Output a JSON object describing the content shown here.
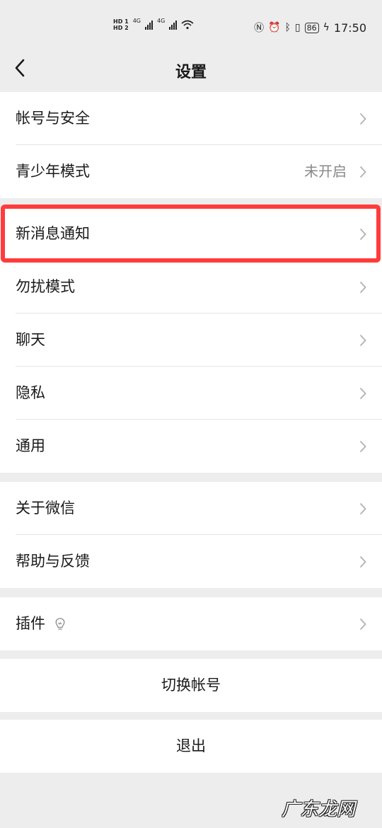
{
  "status_bar": {
    "hd1": "HD 1",
    "hd2": "HD 2",
    "network_1": "4G",
    "network_2": "4G",
    "battery": "86",
    "time": "17:50",
    "icons": [
      "wifi-icon",
      "nfc-icon",
      "alarm-icon",
      "bluetooth-icon",
      "vibrate-icon",
      "charging-icon"
    ]
  },
  "nav": {
    "title": "设置",
    "back_icon": "chevron-left-icon"
  },
  "groups": [
    {
      "items": [
        {
          "label": "帐号与安全",
          "value": ""
        },
        {
          "label": "青少年模式",
          "value": "未开启"
        }
      ]
    },
    {
      "items": [
        {
          "label": "新消息通知",
          "value": ""
        },
        {
          "label": "勿扰模式",
          "value": ""
        },
        {
          "label": "聊天",
          "value": ""
        },
        {
          "label": "隐私",
          "value": ""
        },
        {
          "label": "通用",
          "value": ""
        }
      ]
    },
    {
      "items": [
        {
          "label": "关于微信",
          "value": ""
        },
        {
          "label": "帮助与反馈",
          "value": ""
        }
      ]
    },
    {
      "items": [
        {
          "label": "插件",
          "value": "",
          "icon": "lightbulb-icon"
        }
      ]
    }
  ],
  "actions": {
    "switch_account": "切换帐号",
    "logout": "退出"
  },
  "watermark": "广东龙网",
  "colors": {
    "background": "#ededed",
    "highlight_border": "#ff3b3b",
    "secondary_text": "#888888"
  }
}
